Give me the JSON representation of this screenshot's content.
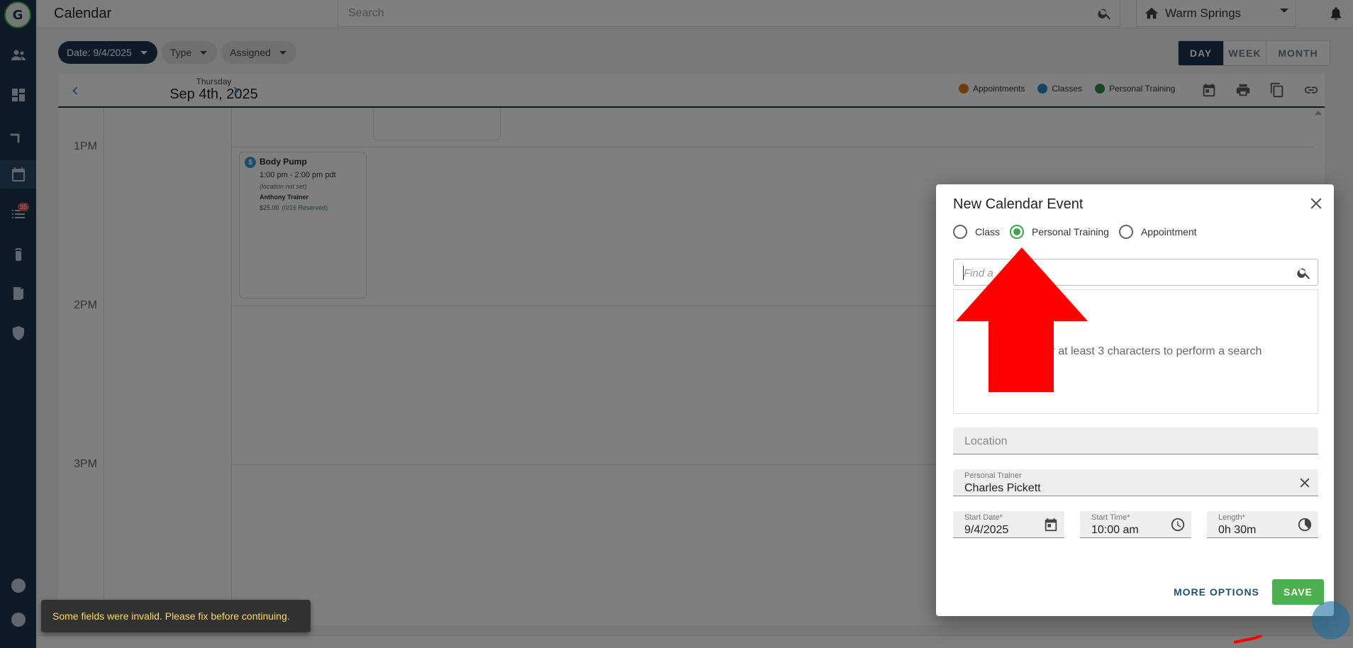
{
  "app": {
    "title": "Calendar",
    "search_placeholder": "Search",
    "location": "Warm Springs",
    "tasks_badge": "35"
  },
  "filters": {
    "date": "Date: 9/4/2025",
    "type": "Type",
    "assigned": "Assigned"
  },
  "views": {
    "day": "DAY",
    "week": "WEEK",
    "month": "MONTH",
    "active": "DAY"
  },
  "calendar": {
    "weekday": "Thursday",
    "date": "Sep 4th, 2025",
    "legend": [
      {
        "label": "Appointments",
        "color": "#e07b1a"
      },
      {
        "label": "Classes",
        "color": "#2a8ac8"
      },
      {
        "label": "Personal Training",
        "color": "#2e8b3e"
      }
    ],
    "times": [
      "1PM",
      "2PM",
      "3PM"
    ],
    "event": {
      "icon": "$",
      "name": "Body Pump",
      "time": "1:00 pm - 2:00 pm pdt",
      "location": "(location not set)",
      "trainer": "Anthony Trainer",
      "price": "$25.00",
      "reserved": "(0/16 Reserved)"
    }
  },
  "dialog": {
    "title": "New Calendar Event",
    "radios": [
      "Class",
      "Personal Training",
      "Appointment"
    ],
    "selected": "Personal Training",
    "find_placeholder": "Find a",
    "find_hint": "er at least 3 characters to perform a search",
    "location_placeholder": "Location",
    "trainer_label": "Personal Trainer",
    "trainer_value": "Charles Pickett",
    "start_date_label": "Start Date*",
    "start_date_value": "9/4/2025",
    "start_time_label": "Start Time*",
    "start_time_value": "10:00 am",
    "length_label": "Length*",
    "length_value": "0h  30m",
    "more_options": "MORE OPTIONS",
    "save": "SAVE"
  },
  "snackbar": "Some fields were invalid. Please fix before continuing.",
  "colors": {
    "brand": "#1d3550",
    "success": "#4caf50",
    "annotation_arrow": "#ff0000"
  }
}
